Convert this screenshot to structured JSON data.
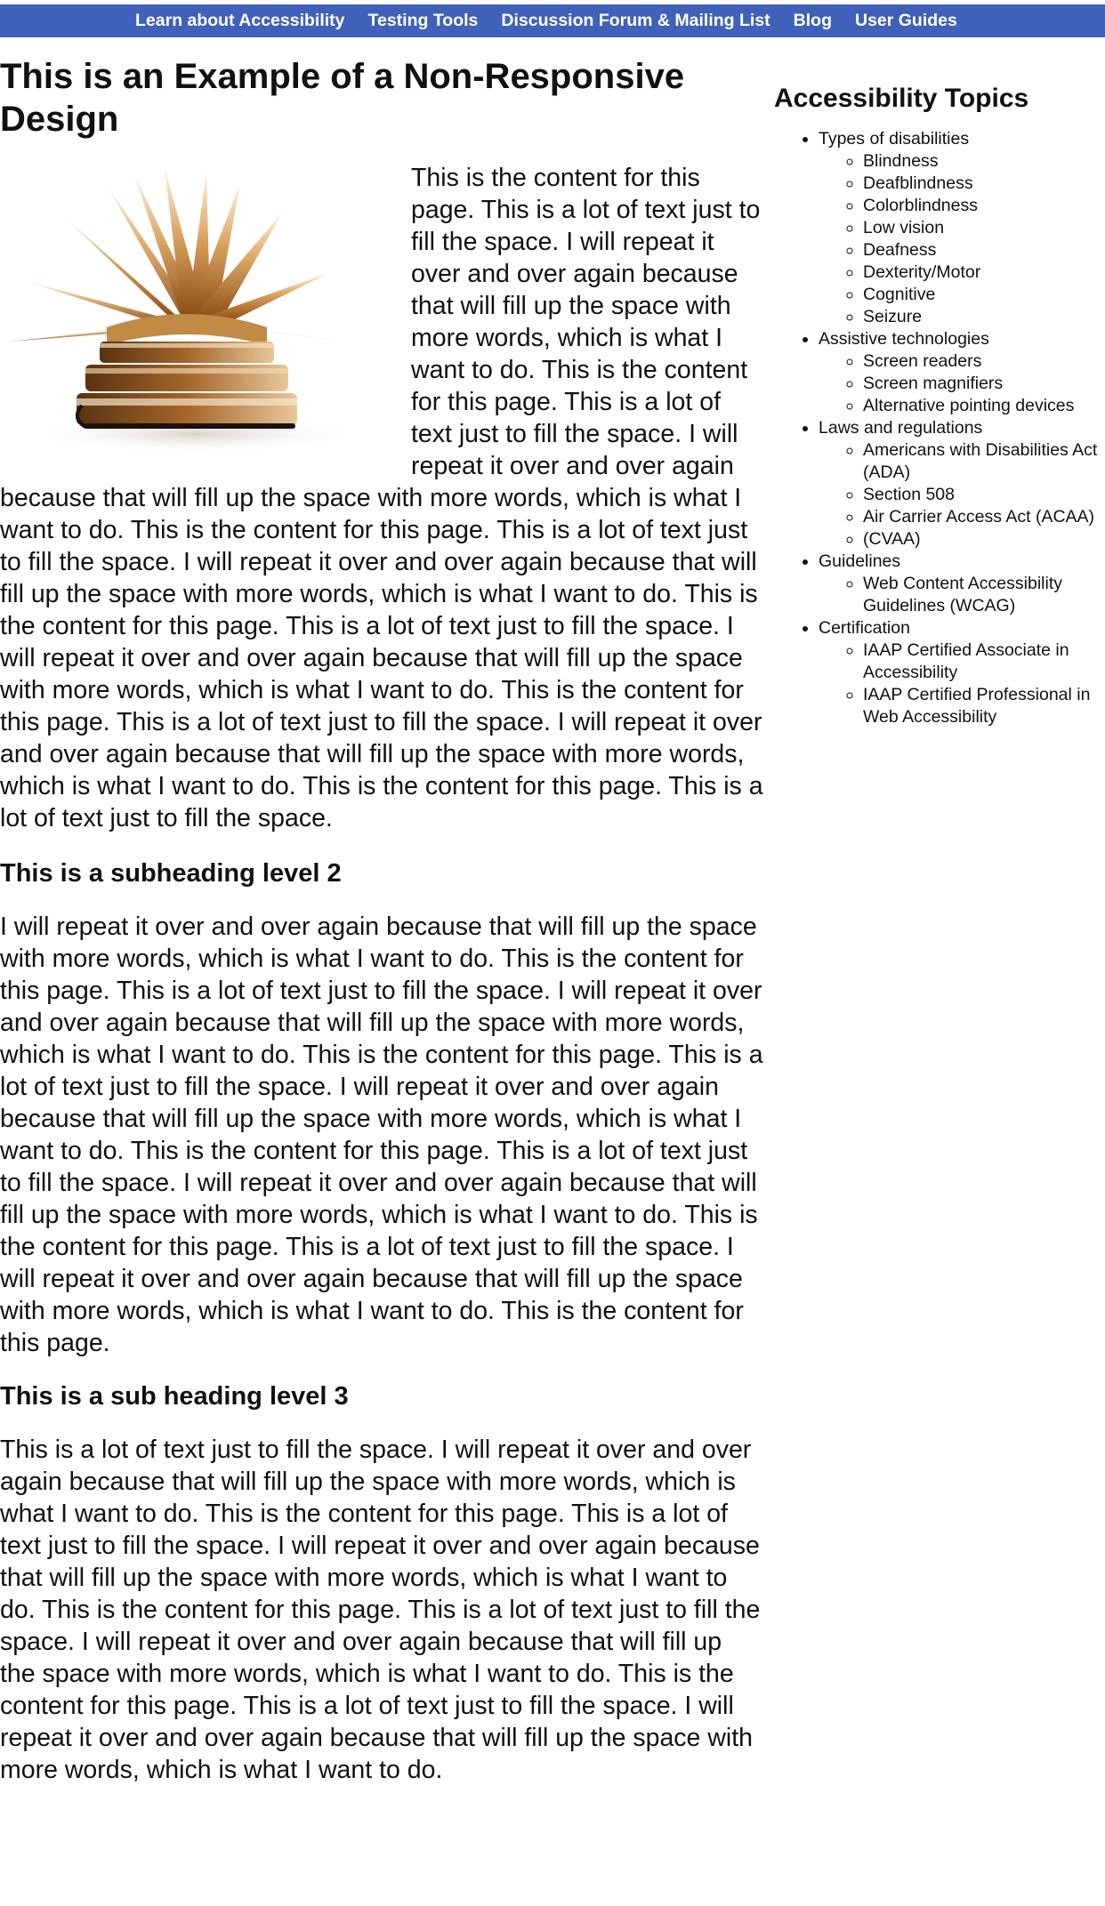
{
  "nav": {
    "items": [
      "Learn about Accessibility",
      "Testing Tools",
      "Discussion Forum & Mailing List",
      "Blog",
      "User Guides"
    ]
  },
  "main": {
    "title": "This is an Example of a Non-Responsive Design",
    "intro": "This is the content for this page. This is a lot of text just to fill the space. I will repeat it over and over again because that will fill up the space with more words, which is what I want to do. This is the content for this page. This is a lot of text just to fill the space. I will repeat it over and over again because that will fill up the space with more words, which is what I want to do. This is the content for this page. This is a lot of text just to fill the space. I will repeat it over and over again because that will fill up the space with more words, which is what I want to do. This is the content for this page. This is a lot of text just to fill the space. I will repeat it over and over again because that will fill up the space with more words, which is what I want to do. This is the content for this page. This is a lot of text just to fill the space. I will repeat it over and over again because that will fill up the space with more words, which is what I want to do. This is the content for this page. This is a lot of text just to fill the space.",
    "subheading2": "This is a subheading level 2",
    "para2": "I will repeat it over and over again because that will fill up the space with more words, which is what I want to do. This is the content for this page. This is a lot of text just to fill the space. I will repeat it over and over again because that will fill up the space with more words, which is what I want to do. This is the content for this page. This is a lot of text just to fill the space. I will repeat it over and over again because that will fill up the space with more words, which is what I want to do. This is the content for this page. This is a lot of text just to fill the space. I will repeat it over and over again because that will fill up the space with more words, which is what I want to do. This is the content for this page. This is a lot of text just to fill the space. I will repeat it over and over again because that will fill up the space with more words, which is what I want to do. This is the content for this page.",
    "subheading3": "This is a sub heading level 3",
    "para3": "This is a lot of text just to fill the space. I will repeat it over and over again because that will fill up the space with more words, which is what I want to do. This is the content for this page. This is a lot of text just to fill the space. I will repeat it over and over again because that will fill up the space with more words, which is what I want to do. This is the content for this page. This is a lot of text just to fill the space. I will repeat it over and over again because that will fill up the space with more words, which is what I want to do. This is the content for this page. This is a lot of text just to fill the space. I will repeat it over and over again because that will fill up the space with more words, which is what I want to do."
  },
  "sidebar": {
    "title": "Accessibility Topics",
    "groups": [
      {
        "label": "Types of disabilities",
        "items": [
          "Blindness",
          "Deafblindness",
          "Colorblindness",
          "Low vision",
          "Deafness",
          "Dexterity/Motor",
          "Cognitive",
          "Seizure"
        ]
      },
      {
        "label": "Assistive technologies",
        "items": [
          "Screen readers",
          "Screen magnifiers",
          "Alternative pointing devices"
        ]
      },
      {
        "label": "Laws and regulations",
        "items": [
          "Americans with Disabilities Act (ADA)",
          "Section 508",
          "Air Carrier Access Act (ACAA)",
          "(CVAA)"
        ]
      },
      {
        "label": "Guidelines",
        "items": [
          "Web Content Accessibility Guidelines (WCAG)"
        ]
      },
      {
        "label": "Certification",
        "items": [
          "IAAP Certified Associate in Accessibility",
          "IAAP Certified Professional in Web Accessibility"
        ]
      }
    ]
  },
  "colors": {
    "nav_background": "#3f61b9",
    "nav_text": "#ffffff",
    "body_text": "#111111"
  }
}
